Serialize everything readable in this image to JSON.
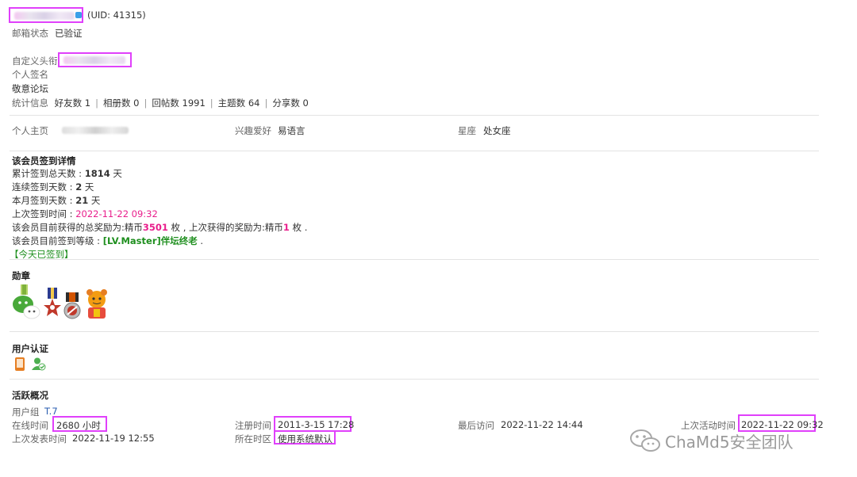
{
  "profile": {
    "uid_text": "(UID: 41315)",
    "email_label": "邮箱状态",
    "email_value": "已验证",
    "custom_title_label": "自定义头衔",
    "signature_label": "个人签名",
    "signature_value": "敬意论坛",
    "stats_label": "统计信息",
    "stats": [
      "好友数 1",
      "相册数 0",
      "回帖数 1991",
      "主题数 64",
      "分享数 0"
    ],
    "homepage_label": "个人主页",
    "interest_label": "兴趣爱好",
    "interest_value": "易语言",
    "zodiac_label": "星座",
    "zodiac_value": "处女座"
  },
  "signin": {
    "title": "该会员签到详情",
    "total_label": "累计签到总天数 : ",
    "total_value": "1814",
    "total_unit": " 天",
    "streak_label": "连续签到天数 : ",
    "streak_value": "2",
    "streak_unit": " 天",
    "month_label": "本月签到天数 : ",
    "month_value": "21",
    "month_unit": " 天",
    "last_label": "上次签到时间 : ",
    "last_value": "2022-11-22 09:32",
    "reward_prefix": "该会员目前获得的总奖励为:精币",
    "reward_total": "3501",
    "reward_mid": " 枚 , 上次获得的奖励为:精币",
    "reward_last": "1",
    "reward_suffix": " 枚 .",
    "level_prefix": "该会员目前签到等级 : ",
    "level_value": "[LV.Master]伴坛终老",
    "level_suffix": " .",
    "today_status": "【今天已签到】"
  },
  "medals": {
    "title": "勋章",
    "items": [
      "wechat-medal-icon",
      "star-ribbon-medal-icon",
      "badge-ribbon-medal-icon",
      "tiger-medal-icon"
    ]
  },
  "auth": {
    "title": "用户认证",
    "items": [
      "phone-verify-icon",
      "user-verify-icon"
    ]
  },
  "activity": {
    "title": "活跃概况",
    "group_label": "用户组",
    "group_value": "T.7",
    "online_label": "在线时间",
    "online_value": "2680 小时",
    "register_label": "注册时间",
    "register_value": "2011-3-15 17:28",
    "last_visit_label": "最后访问",
    "last_visit_value": "2022-11-22 14:44",
    "last_active_label": "上次活动时间",
    "last_active_value": "2022-11-22 09:32",
    "last_post_label": "上次发表时间",
    "last_post_value": "2022-11-19 12:55",
    "timezone_label": "所在时区",
    "timezone_value": "使用系统默认"
  },
  "watermark": {
    "text": "ChaMd5安全团队",
    "icon": "wechat-logo-icon"
  },
  "colors": {
    "highlight": "#e040fb",
    "accent_pink": "#e91e8c",
    "accent_green": "#1f8f1f",
    "link_blue": "#2a5db0"
  }
}
